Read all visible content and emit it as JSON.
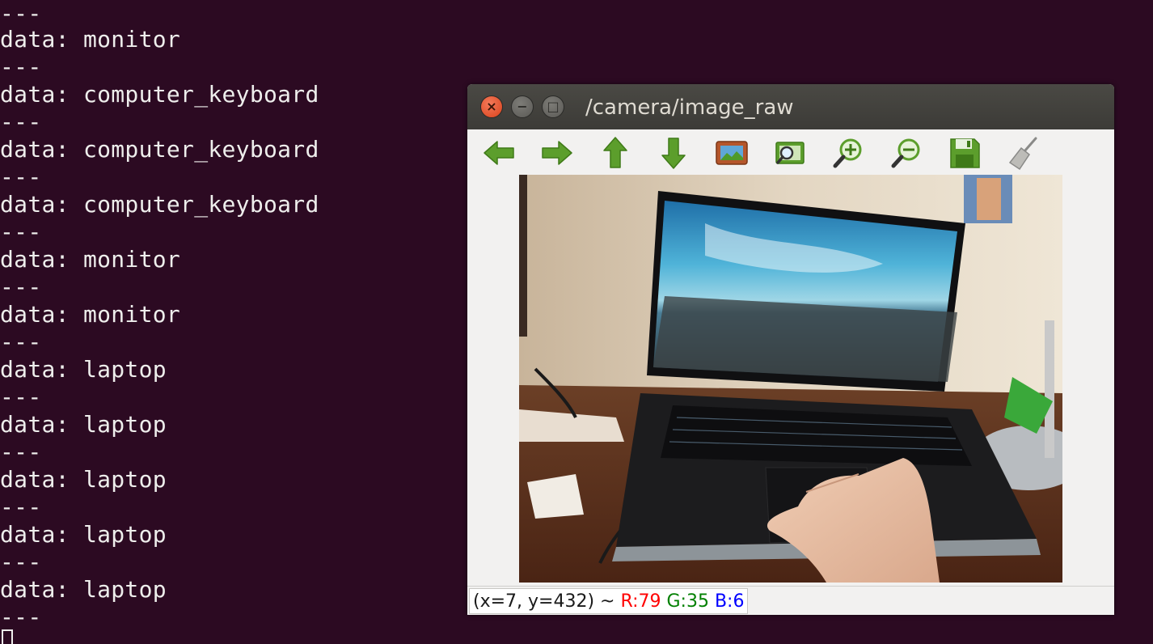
{
  "terminal": {
    "separator": "---",
    "lines": [
      "data: monitor",
      "data: computer_keyboard",
      "data: computer_keyboard",
      "data: computer_keyboard",
      "data: monitor",
      "data: monitor",
      "data: laptop",
      "data: laptop",
      "data: laptop",
      "data: laptop",
      "data: laptop"
    ]
  },
  "window": {
    "title": "/camera/image_raw",
    "buttons": {
      "close": "×",
      "minimize": "−",
      "maximize": "□"
    },
    "toolbar": [
      {
        "icon": "arrow-left-icon"
      },
      {
        "icon": "arrow-right-icon"
      },
      {
        "icon": "arrow-up-icon"
      },
      {
        "icon": "arrow-down-icon"
      },
      {
        "icon": "fit-image-icon"
      },
      {
        "icon": "zoom-fit-icon"
      },
      {
        "icon": "zoom-in-icon"
      },
      {
        "icon": "zoom-out-icon"
      },
      {
        "icon": "save-icon"
      },
      {
        "icon": "clear-icon"
      }
    ],
    "status": {
      "coords": "(x=7, y=432) ~ ",
      "r": "R:79",
      "g": "G:35",
      "b": "B:6"
    }
  },
  "colors": {
    "terminal_bg": "#2c0a22",
    "icon_green": "#5c9e2c",
    "status_r": "#ff0000",
    "status_g": "#008000",
    "status_b": "#0000ff"
  }
}
